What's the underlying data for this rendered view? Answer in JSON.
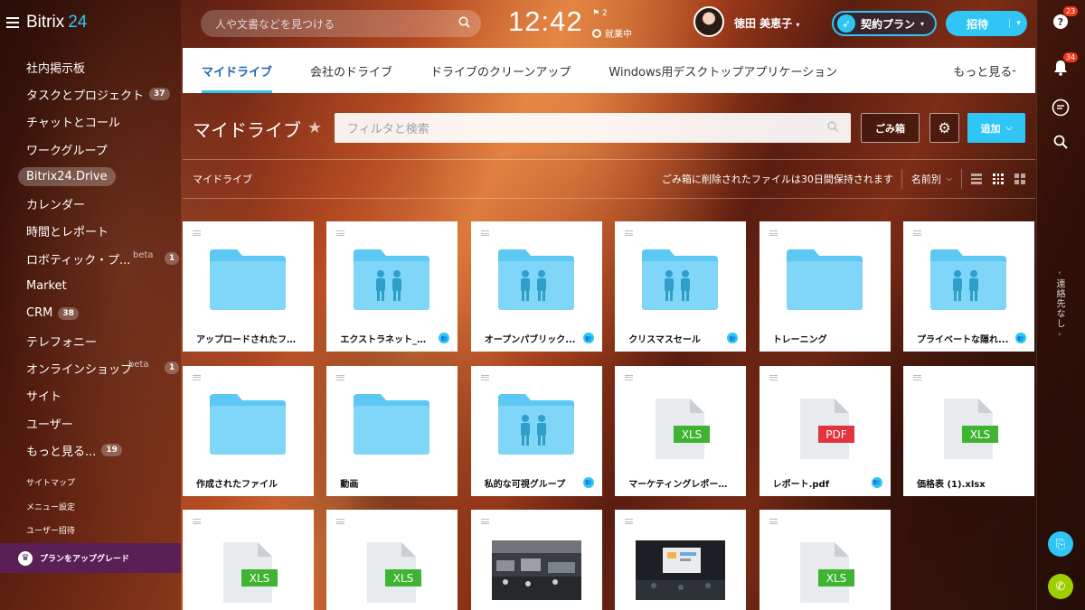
{
  "app": {
    "logo": "Bitrix",
    "logo_num": "24"
  },
  "sidebar": {
    "items": [
      {
        "label": "社内掲示板"
      },
      {
        "label": "タスクとプロジェクト",
        "counter": "37"
      },
      {
        "label": "チャットとコール"
      },
      {
        "label": "ワークグループ"
      },
      {
        "label": "Bitrix24.Drive",
        "active": true
      },
      {
        "label": "カレンダー"
      },
      {
        "label": "時間とレポート"
      },
      {
        "label": "ロボティック・プ...",
        "beta": "beta",
        "counter": "1"
      },
      {
        "label": "Market"
      },
      {
        "label": "CRM",
        "counter": "38"
      },
      {
        "label": "テレフォニー"
      },
      {
        "label": "オンラインショップ",
        "beta": "beta",
        "counter": "1"
      },
      {
        "label": "サイト"
      },
      {
        "label": "ユーザー"
      },
      {
        "label": "もっと見る...",
        "counter": "19"
      }
    ],
    "small_links": [
      "サイトマップ",
      "メニュー設定",
      "ユーザー招待"
    ],
    "upgrade_label": "プランをアップグレード"
  },
  "header": {
    "search_placeholder": "人や文書などを見つける",
    "clock": "12:42",
    "flag_count": "2",
    "status": "就業中",
    "user_name": "徳田 美恵子",
    "plan_label": "契約プラン",
    "invite_label": "招待"
  },
  "rightbar": {
    "help_badge": "23",
    "notif_badge": "34",
    "vertical_text": "連絡先なし"
  },
  "tabs": [
    {
      "label": "マイドライブ",
      "active": true
    },
    {
      "label": "会社のドライブ"
    },
    {
      "label": "ドライブのクリーンアップ"
    },
    {
      "label": "Windows用デスクトップアプリケーション"
    },
    {
      "label": "もっと見る"
    }
  ],
  "toolbar": {
    "title": "マイドライブ",
    "filter_placeholder": "フィルタと検索",
    "trash_label": "ごみ箱",
    "add_label": "追加"
  },
  "crumb_bar": {
    "crumb": "マイドライブ",
    "notice": "ごみ箱に削除されたファイルは30日間保持されます",
    "sort_label": "名前別"
  },
  "files": [
    {
      "name": "アップロードされたファ...",
      "kind": "folder",
      "people": false,
      "shared": false
    },
    {
      "name": "エクストラネット_外...",
      "kind": "folder",
      "people": true,
      "shared": true
    },
    {
      "name": "オープンパブリック...",
      "kind": "folder",
      "people": true,
      "shared": true
    },
    {
      "name": "クリスマスセール",
      "kind": "folder",
      "people": true,
      "shared": true
    },
    {
      "name": "トレーニング",
      "kind": "folder",
      "people": false,
      "shared": false
    },
    {
      "name": "プライベートな隠れ...",
      "kind": "folder",
      "people": true,
      "shared": true
    },
    {
      "name": "作成されたファイル",
      "kind": "folder",
      "people": false,
      "shared": false
    },
    {
      "name": "動画",
      "kind": "folder",
      "people": false,
      "shared": false
    },
    {
      "name": "私的な可視グループ",
      "kind": "folder",
      "people": true,
      "shared": true
    },
    {
      "name": "マーケティングレポート...",
      "kind": "doc",
      "badge": "XLS",
      "shared": false
    },
    {
      "name": "レポート.pdf",
      "kind": "doc",
      "badge": "PDF",
      "shared": true
    },
    {
      "name": "価格表 (1).xlsx",
      "kind": "doc",
      "badge": "XLS",
      "shared": false
    },
    {
      "name": "",
      "kind": "doc",
      "badge": "XLS",
      "shared": false
    },
    {
      "name": "",
      "kind": "doc",
      "badge": "XLS",
      "shared": false
    },
    {
      "name": "",
      "kind": "photo",
      "shared": false
    },
    {
      "name": "",
      "kind": "photo2",
      "shared": false
    },
    {
      "name": "",
      "kind": "doc",
      "badge": "XLS",
      "shared": false
    }
  ],
  "colors": {
    "accent": "#2fc6f6",
    "xls": "#3fb433",
    "pdf": "#e2333e",
    "folder": "#7fd6f9",
    "upgrade": "#5a1f55"
  }
}
